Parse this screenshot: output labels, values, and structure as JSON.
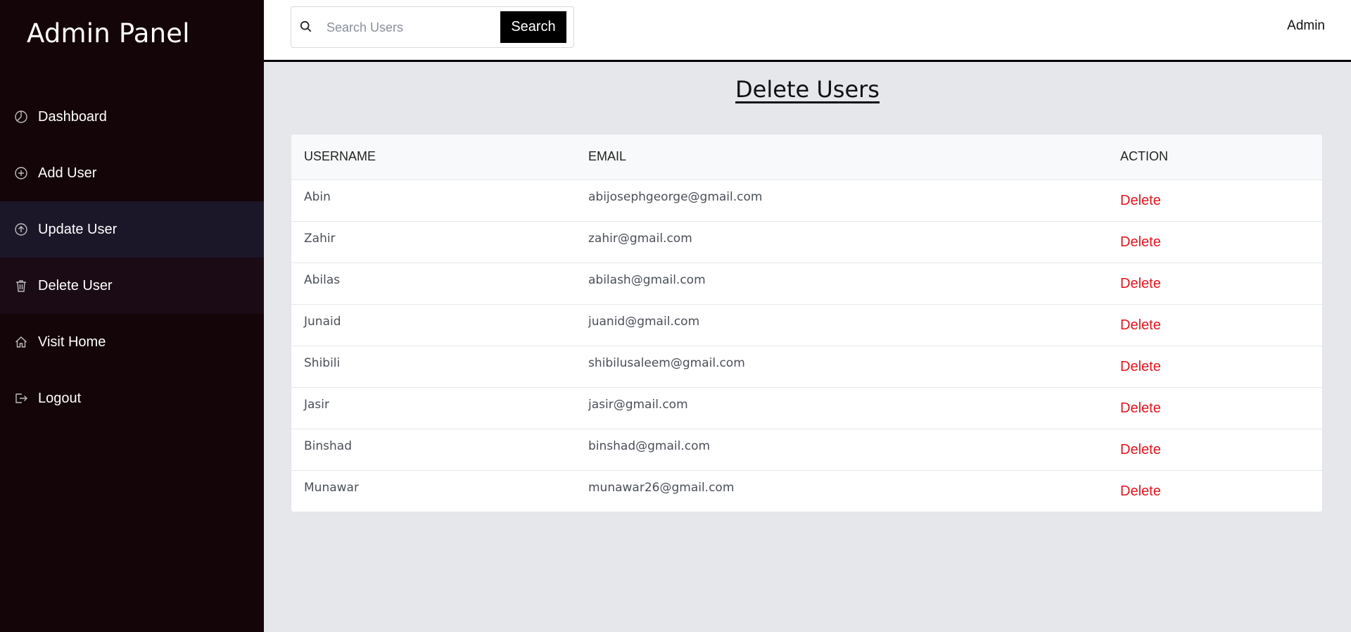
{
  "sidebar": {
    "title": "Admin Panel",
    "items": [
      {
        "label": "Dashboard",
        "icon": "pie-chart-icon"
      },
      {
        "label": "Add User",
        "icon": "plus-circle-icon"
      },
      {
        "label": "Update User",
        "icon": "arrow-up-circle-icon"
      },
      {
        "label": "Delete User",
        "icon": "trash-icon"
      },
      {
        "label": "Visit Home",
        "icon": "home-icon"
      },
      {
        "label": "Logout",
        "icon": "logout-icon"
      }
    ]
  },
  "header": {
    "search_placeholder": "Search Users",
    "search_button": "Search",
    "user_label": "Admin"
  },
  "main": {
    "title": "Delete Users",
    "table": {
      "columns": [
        "USERNAME",
        "EMAIL",
        "ACTION"
      ],
      "action_label": "Delete",
      "rows": [
        {
          "username": "Abin",
          "email": "abijosephgeorge@gmail.com"
        },
        {
          "username": "Zahir",
          "email": "zahir@gmail.com"
        },
        {
          "username": "Abilas",
          "email": "abilash@gmail.com"
        },
        {
          "username": "Junaid",
          "email": "juanid@gmail.com"
        },
        {
          "username": "Shibili",
          "email": "shibilusaleem@gmail.com"
        },
        {
          "username": "Jasir",
          "email": "jasir@gmail.com"
        },
        {
          "username": "Binshad",
          "email": "binshad@gmail.com"
        },
        {
          "username": "Munawar",
          "email": "munawar26@gmail.com"
        }
      ]
    }
  },
  "colors": {
    "sidebar_bg": "#140508",
    "accent_delete": "#e8121b",
    "button_bg": "#000000"
  }
}
